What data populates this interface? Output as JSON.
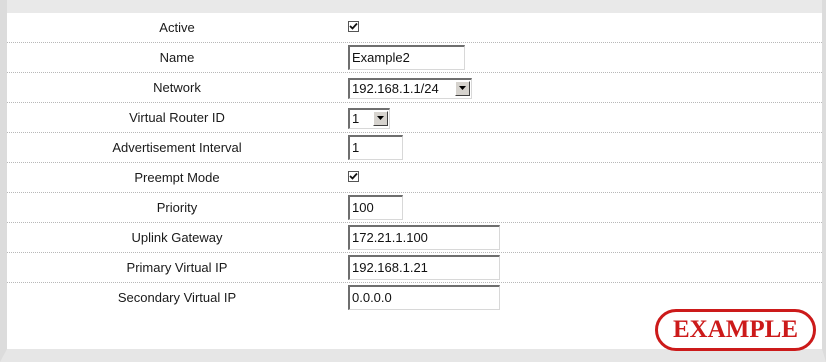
{
  "form": {
    "active": {
      "label": "Active",
      "checked": true
    },
    "name": {
      "label": "Name",
      "value": "Example2"
    },
    "network": {
      "label": "Network",
      "value": "192.168.1.1/24"
    },
    "virtual_router_id": {
      "label": "Virtual Router ID",
      "value": "1"
    },
    "advertisement_interval": {
      "label": "Advertisement Interval",
      "value": "1"
    },
    "preempt_mode": {
      "label": "Preempt Mode",
      "checked": true
    },
    "priority": {
      "label": "Priority",
      "value": "100"
    },
    "uplink_gateway": {
      "label": "Uplink Gateway",
      "value": "172.21.1.100"
    },
    "primary_virtual_ip": {
      "label": "Primary Virtual IP",
      "value": "192.168.1.21"
    },
    "secondary_virtual_ip": {
      "label": "Secondary Virtual IP",
      "value": "0.0.0.0"
    }
  },
  "watermark": {
    "text": "EXAMPLE"
  },
  "colors": {
    "accent": "#cc1a1a",
    "frame": "#dcdcdc"
  }
}
